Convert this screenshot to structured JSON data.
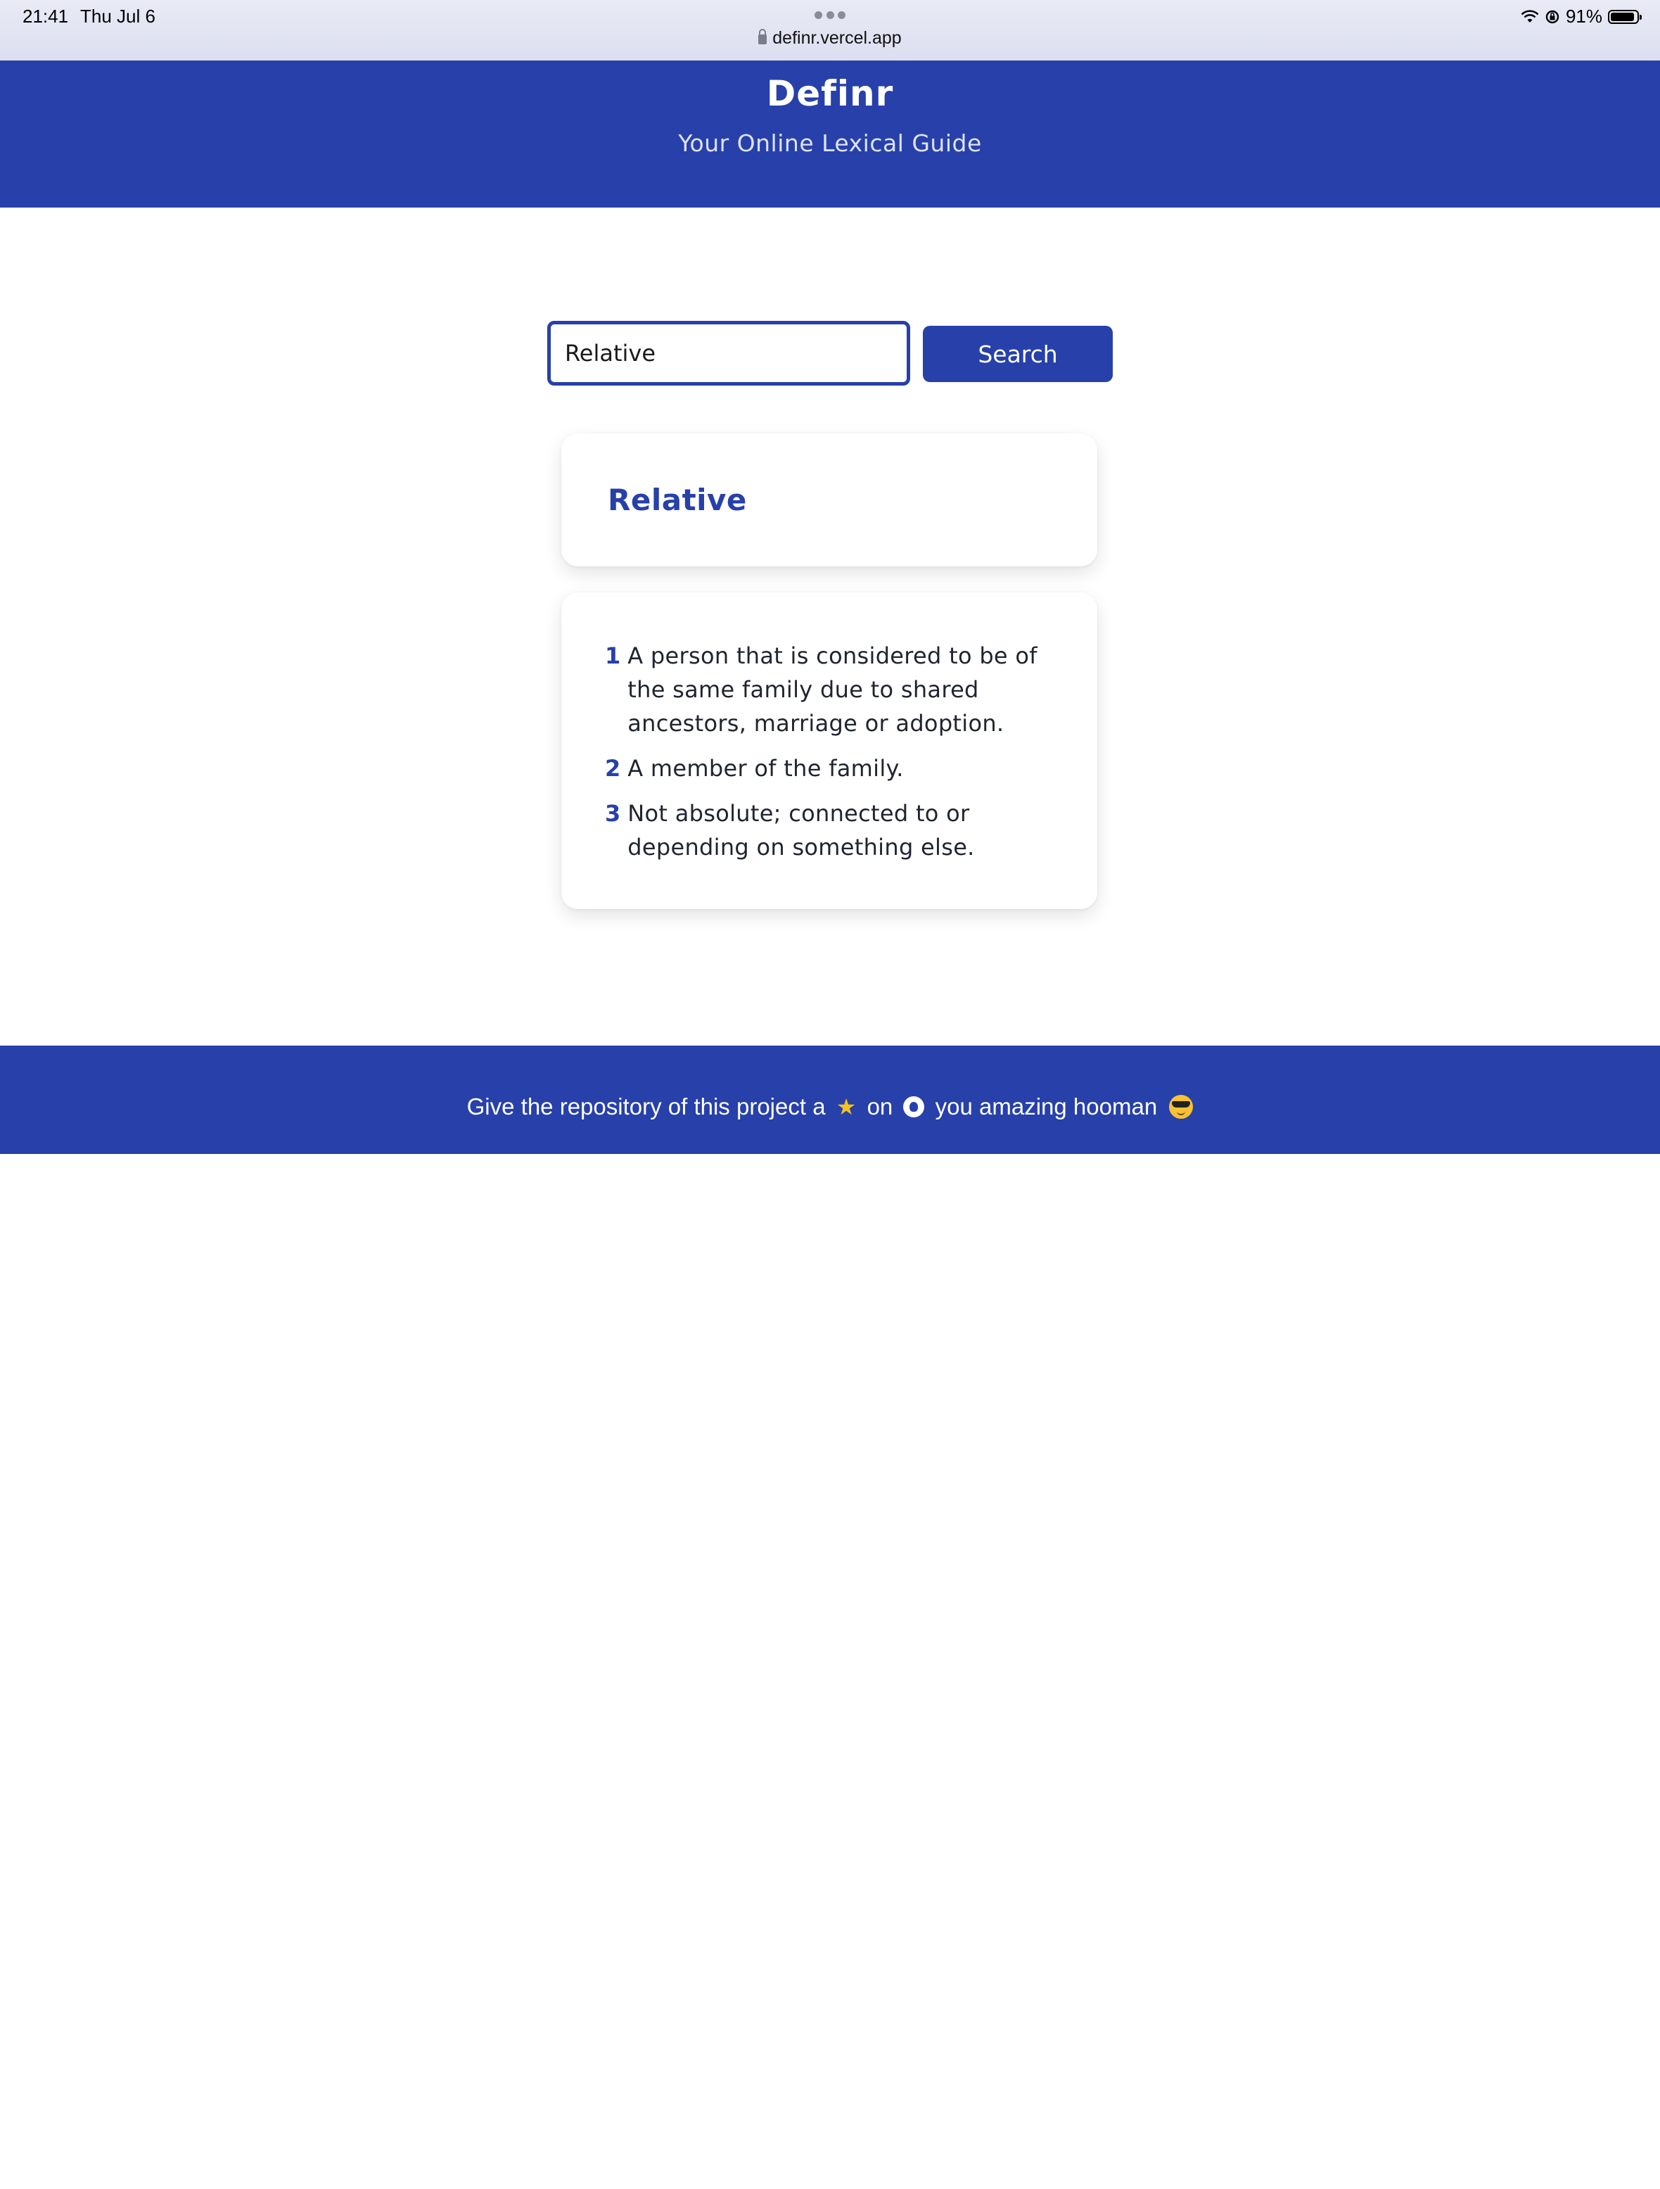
{
  "status_bar": {
    "time": "21:41",
    "date": "Thu Jul 6",
    "url": "definr.vercel.app",
    "battery": "91%",
    "battery_level": 0.91
  },
  "header": {
    "title": "Definr",
    "subtitle": "Your Online Lexical Guide"
  },
  "search": {
    "value": "Relative",
    "button_label": "Search"
  },
  "result": {
    "word": "Relative",
    "definitions": [
      {
        "num": "1",
        "text": "A person that is considered to be of the same family due to shared ancestors, marriage or adoption."
      },
      {
        "num": "2",
        "text": "A member of the family."
      },
      {
        "num": "3",
        "text": "Not absolute; connected to or depending on something else."
      }
    ]
  },
  "footer": {
    "text_before": "Give the repository of this project a",
    "text_middle": "on",
    "text_after": "you amazing hooman",
    "star_glyph": "★"
  },
  "colors": {
    "primary": "#2740aa",
    "star": "#f6c21c"
  }
}
